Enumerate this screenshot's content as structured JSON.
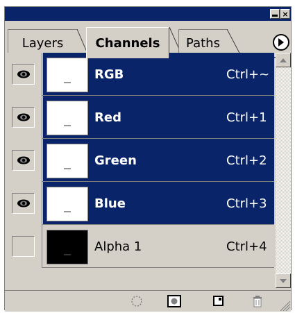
{
  "window": {
    "minimize_icon": "minimize-icon",
    "close_icon": "close-icon",
    "close_glyph": "×"
  },
  "tabs": [
    {
      "label": "Layers",
      "active": false
    },
    {
      "label": "Channels",
      "active": true
    },
    {
      "label": "Paths",
      "active": false
    }
  ],
  "channels": [
    {
      "name": "RGB",
      "shortcut": "Ctrl+~",
      "visible": true,
      "selected": true,
      "thumb": "white"
    },
    {
      "name": "Red",
      "shortcut": "Ctrl+1",
      "visible": true,
      "selected": true,
      "thumb": "white"
    },
    {
      "name": "Green",
      "shortcut": "Ctrl+2",
      "visible": true,
      "selected": true,
      "thumb": "white"
    },
    {
      "name": "Blue",
      "shortcut": "Ctrl+3",
      "visible": true,
      "selected": true,
      "thumb": "white"
    },
    {
      "name": "Alpha 1",
      "shortcut": "Ctrl+4",
      "visible": false,
      "selected": false,
      "thumb": "black"
    }
  ],
  "bottom_icons": [
    "load-selection-icon",
    "save-selection-icon",
    "new-channel-icon",
    "trash-icon"
  ],
  "colors": {
    "selection": "#0a246a",
    "panel": "#d4d0c8"
  }
}
